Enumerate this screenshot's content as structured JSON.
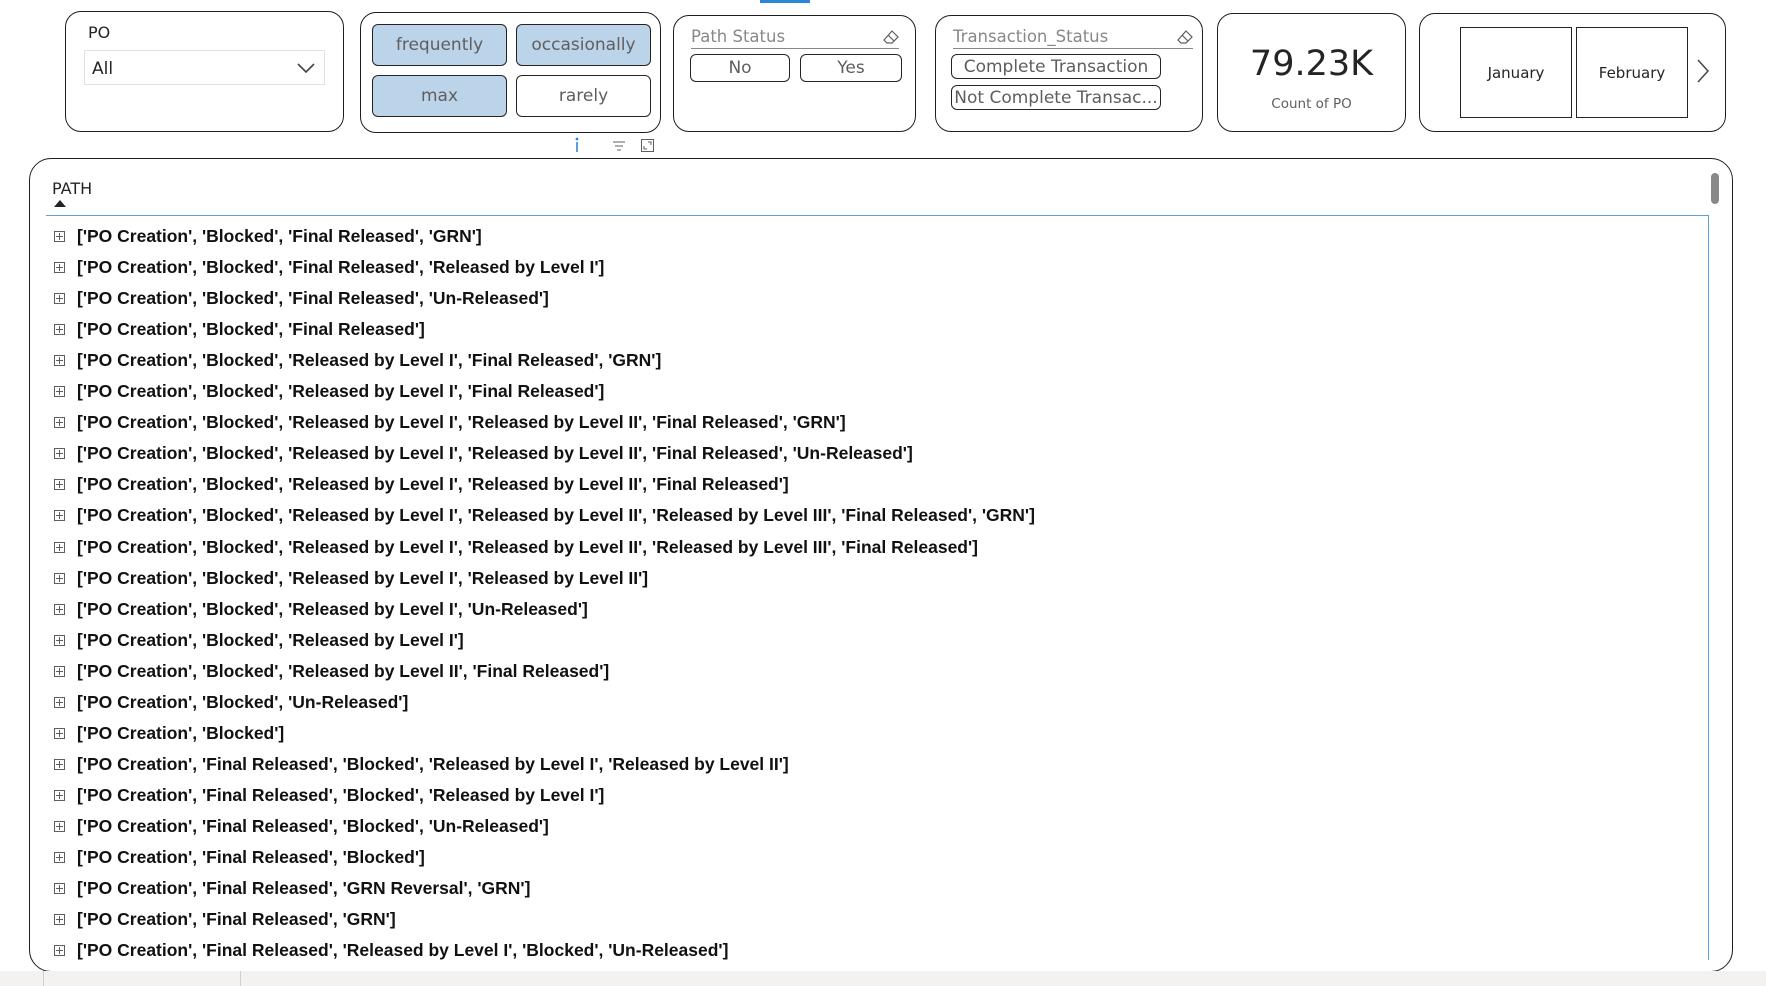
{
  "po_slicer": {
    "label": "PO",
    "selected": "All"
  },
  "frequency_slicer": {
    "buttons": [
      {
        "label": "frequently",
        "selected": true
      },
      {
        "label": "occasionally",
        "selected": true
      },
      {
        "label": "max",
        "selected": true
      },
      {
        "label": "rarely",
        "selected": false
      }
    ]
  },
  "path_status": {
    "title": "Path Status",
    "options": [
      "No",
      "Yes"
    ]
  },
  "transaction_status": {
    "title": "Transaction_Status",
    "options": [
      "Complete Transaction",
      "Not Complete Transac..."
    ]
  },
  "kpi": {
    "value": "79.23K",
    "label": "Count of PO"
  },
  "month_slicer": {
    "months": [
      "January",
      "February"
    ]
  },
  "colors": {
    "selected_fill": "#bcd4ea",
    "accent_line": "#5aa3da",
    "top_tab": "#2b88d8"
  },
  "table": {
    "header": "PATH",
    "rows": [
      "['PO Creation', 'Blocked', 'Final Released', 'GRN']",
      "['PO Creation', 'Blocked', 'Final Released', 'Released by Level I']",
      "['PO Creation', 'Blocked', 'Final Released', 'Un-Released']",
      "['PO Creation', 'Blocked', 'Final Released']",
      "['PO Creation', 'Blocked', 'Released by Level I', 'Final Released', 'GRN']",
      "['PO Creation', 'Blocked', 'Released by Level I', 'Final Released']",
      "['PO Creation', 'Blocked', 'Released by Level I', 'Released by Level II', 'Final Released', 'GRN']",
      "['PO Creation', 'Blocked', 'Released by Level I', 'Released by Level II', 'Final Released', 'Un-Released']",
      "['PO Creation', 'Blocked', 'Released by Level I', 'Released by Level II', 'Final Released']",
      "['PO Creation', 'Blocked', 'Released by Level I', 'Released by Level II', 'Released by Level III', 'Final Released', 'GRN']",
      "['PO Creation', 'Blocked', 'Released by Level I', 'Released by Level II', 'Released by Level III', 'Final Released']",
      "['PO Creation', 'Blocked', 'Released by Level I', 'Released by Level II']",
      "['PO Creation', 'Blocked', 'Released by Level I', 'Un-Released']",
      "['PO Creation', 'Blocked', 'Released by Level I']",
      "['PO Creation', 'Blocked', 'Released by Level II', 'Final Released']",
      "['PO Creation', 'Blocked', 'Un-Released']",
      "['PO Creation', 'Blocked']",
      "['PO Creation', 'Final Released', 'Blocked', 'Released by Level I', 'Released by Level II']",
      "['PO Creation', 'Final Released', 'Blocked', 'Released by Level I']",
      "['PO Creation', 'Final Released', 'Blocked', 'Un-Released']",
      "['PO Creation', 'Final Released', 'Blocked']",
      "['PO Creation', 'Final Released', 'GRN Reversal', 'GRN']",
      "['PO Creation', 'Final Released', 'GRN']",
      "['PO Creation', 'Final Released', 'Released by Level I', 'Blocked', 'Un-Released']"
    ]
  }
}
